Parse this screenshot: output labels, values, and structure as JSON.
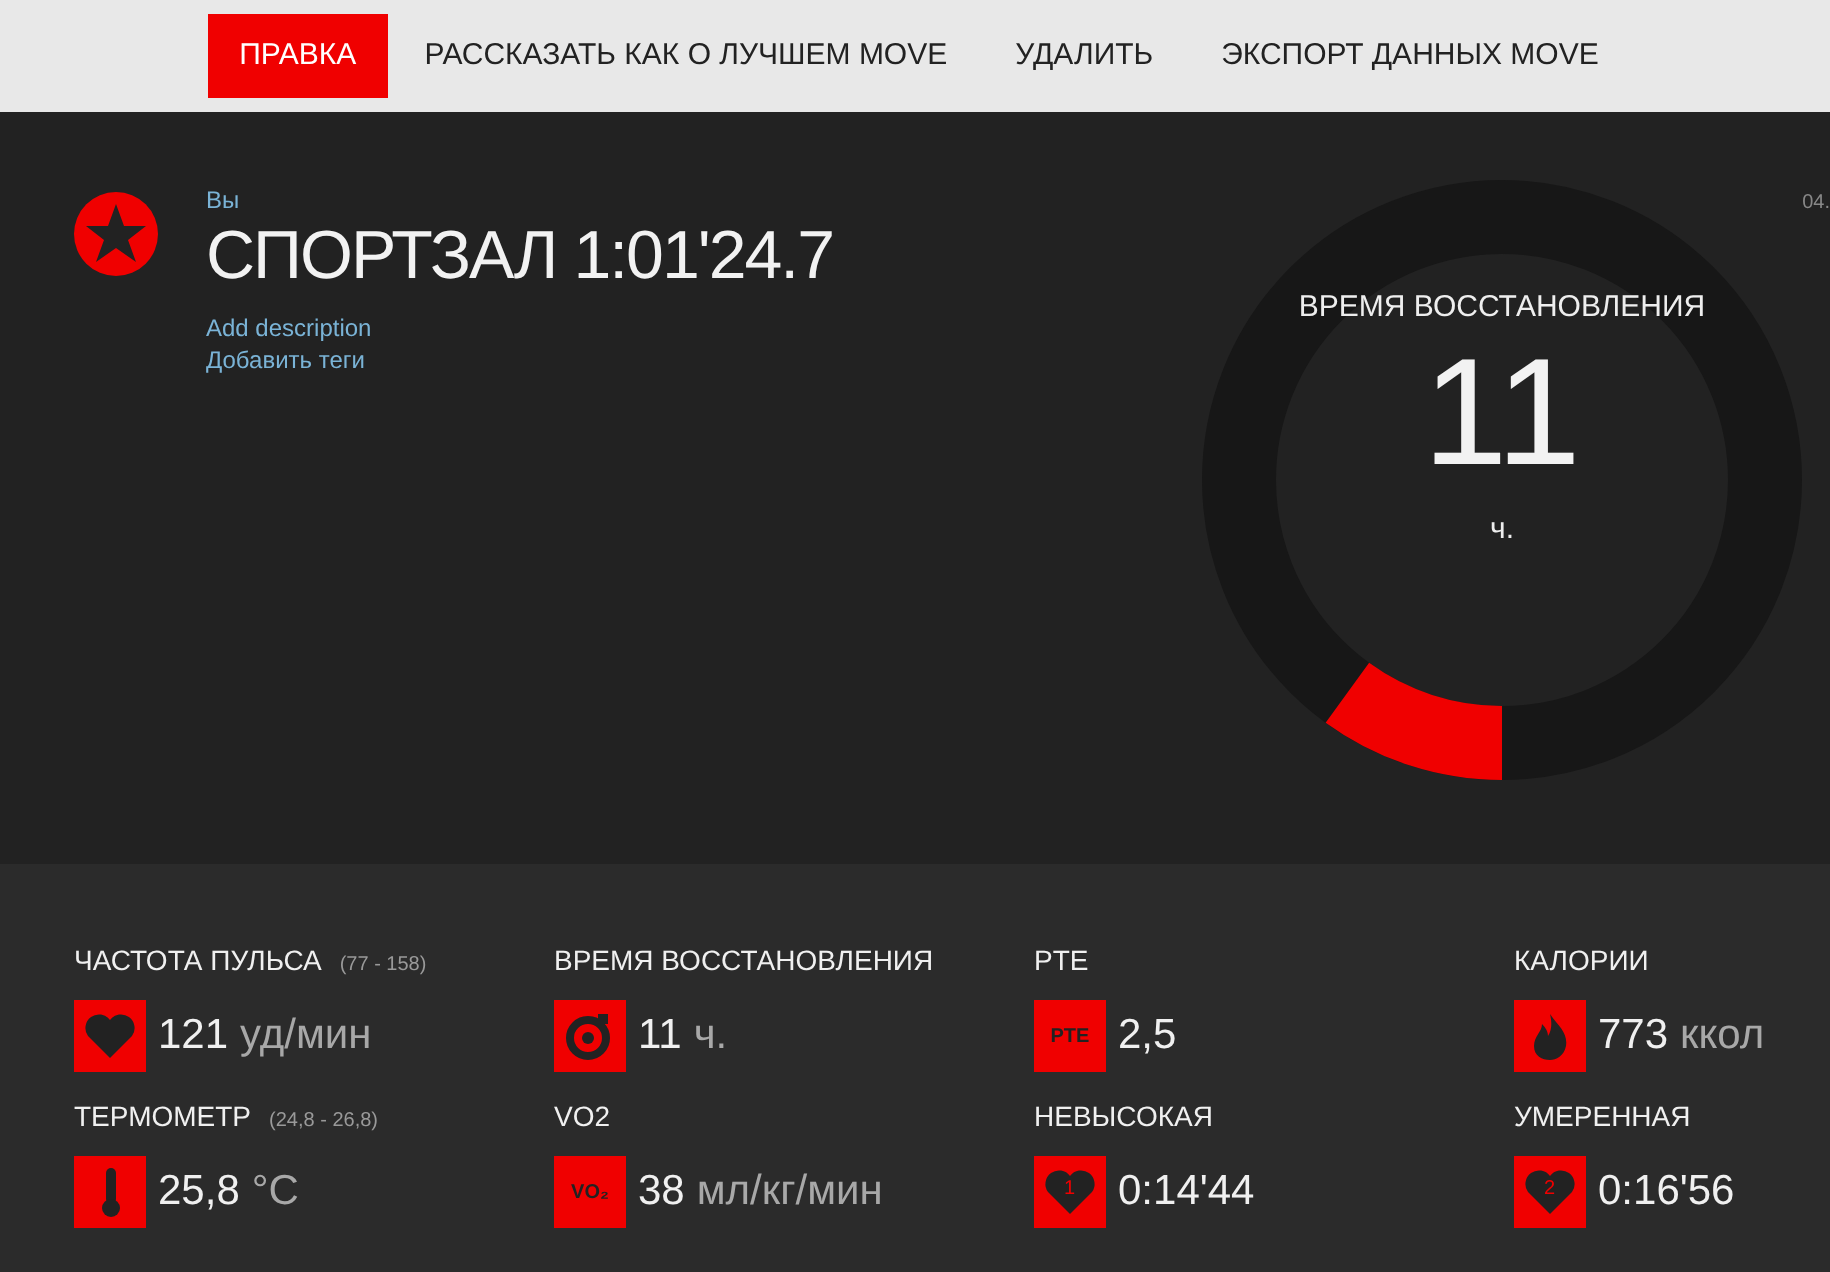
{
  "menu": [
    {
      "label": "ПРАВКА",
      "selected": true
    },
    {
      "label": "РАССКАЗАТЬ КАК О ЛУЧШЕМ MOVE",
      "selected": false
    },
    {
      "label": "УДАЛИТЬ",
      "selected": false
    },
    {
      "label": "ЭКСПОРТ ДАННЫХ MOVE",
      "selected": false
    }
  ],
  "header": {
    "owner": "Вы",
    "title": "СПОРТЗАЛ 1:01'24.7",
    "links": [
      "Add description",
      "Добавить теги"
    ],
    "date": "04."
  },
  "recovery": {
    "label": "ВРЕМЯ ВОССТАНОВЛЕНИЯ",
    "value": "11",
    "unit": "ч.",
    "level": 0.1
  },
  "stats": [
    {
      "label": "ЧАСТОТА ПУЛЬСА",
      "range": "(77 - 158)",
      "kind": "heart",
      "value": "121",
      "unit": "уд/мин"
    },
    {
      "label": "ВРЕМЯ ВОССТАНОВЛЕНИЯ",
      "kind": "timer",
      "value": "11",
      "unit": "ч."
    },
    {
      "label": "PTE",
      "kind": "text",
      "icon_text": "PTE",
      "value": "2,5"
    },
    {
      "label": "КАЛОРИИ",
      "kind": "flame",
      "value": "773",
      "unit": "ккол"
    },
    {
      "label": "ТЕРМОМЕТР",
      "range": "(24,8 - 26,8)",
      "kind": "thermometer",
      "value": "25,8",
      "unit": "°C"
    },
    {
      "label": "VO2",
      "kind": "text",
      "icon_text": "VO₂",
      "value": "38",
      "unit": "мл/кг/мин"
    },
    {
      "label": "НЕВЫСОКАЯ",
      "kind": "zone",
      "icon_text": "1",
      "value": "0:14'44"
    },
    {
      "label": "УМЕРЕННАЯ",
      "kind": "zone",
      "icon_text": "2",
      "value": "0:16'56"
    }
  ]
}
